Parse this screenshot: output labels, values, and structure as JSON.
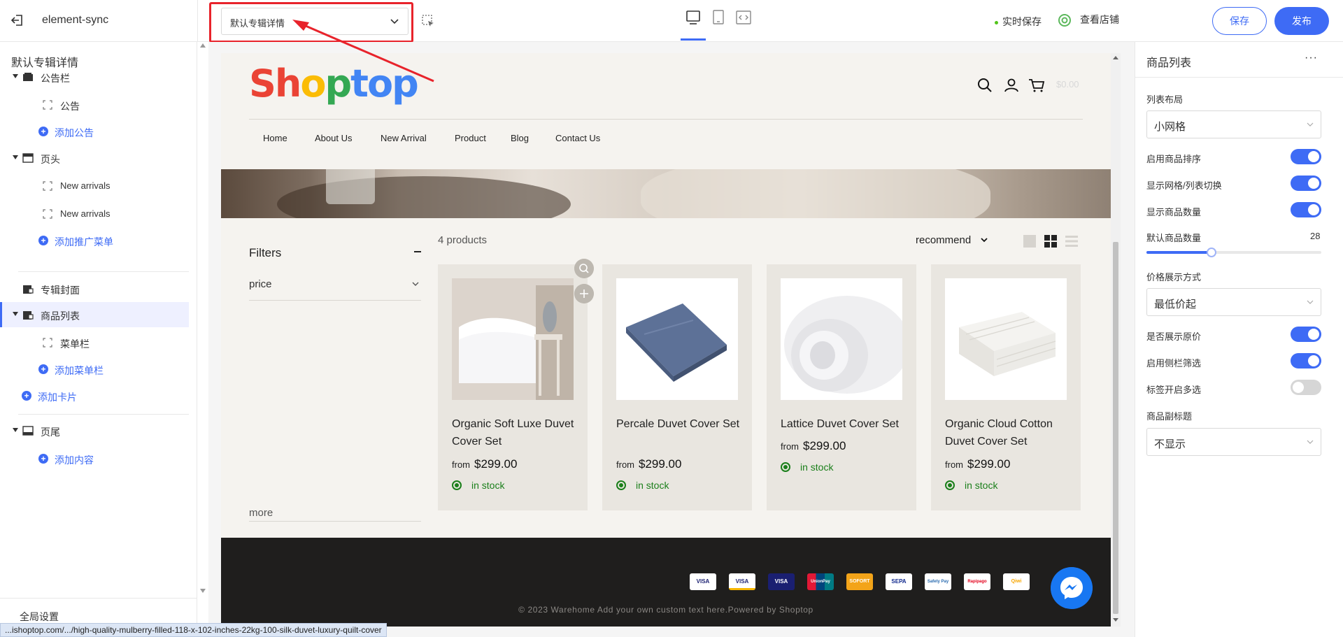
{
  "topbar": {
    "app_title": "element-sync",
    "template_select": "默认专辑详情",
    "autosave": "实时保存",
    "view_store": "查看店铺",
    "save": "保存",
    "publish": "发布",
    "icons": [
      "exit-icon",
      "select-tool-icon",
      "desktop-icon",
      "tablet-icon",
      "code-icon",
      "store-icon"
    ]
  },
  "sidebar": {
    "title": "默认专辑详情",
    "items": [
      {
        "label": "公告栏"
      },
      {
        "label": "公告"
      },
      {
        "label": "添加公告"
      },
      {
        "label": "页头"
      },
      {
        "label": "New arrivals"
      },
      {
        "label": "New arrivals"
      },
      {
        "label": "添加推广菜单"
      },
      {
        "label": "专辑封面"
      },
      {
        "label": "商品列表"
      },
      {
        "label": "菜单栏"
      },
      {
        "label": "添加菜单栏"
      },
      {
        "label": "添加卡片"
      },
      {
        "label": "页尾"
      },
      {
        "label": "添加内容"
      }
    ],
    "global_settings": "全局设置"
  },
  "preview": {
    "logo": {
      "letters": [
        "S",
        "h",
        "o",
        "p",
        "t",
        "o",
        "p"
      ],
      "colors": [
        "#ea4335",
        "#ea4335",
        "#fbbc05",
        "#34a853",
        "#4285f4",
        "#4285f4",
        "#4285f4"
      ]
    },
    "cart_total": "$0.00",
    "nav": [
      "Home",
      "About Us",
      "New Arrival",
      "Product",
      "Blog",
      "Contact Us"
    ],
    "filters": {
      "title": "Filters",
      "price": "price",
      "more": "more"
    },
    "products_count": "4 products",
    "sort": "recommend",
    "products": [
      {
        "name": "Organic Soft Luxe Duvet Cover Set",
        "from": "from",
        "price": "$299.00",
        "stock": "in stock"
      },
      {
        "name": "Percale Duvet Cover Set",
        "from": "from",
        "price": "$299.00",
        "stock": "in stock"
      },
      {
        "name": "Lattice Duvet Cover Set",
        "from": "from",
        "price": "$299.00",
        "stock": "in stock"
      },
      {
        "name": "Organic Cloud Cotton Duvet Cover Set",
        "from": "from",
        "price": "$299.00",
        "stock": "in stock"
      }
    ],
    "payment_icons": [
      "VISA",
      "VISA",
      "VISA",
      "UnionPay",
      "SOFORT",
      "SEPA",
      "Safety Pay",
      "Rapipago",
      "Qiwi"
    ],
    "copyright": "© 2023 Warehome Add your own custom text here.Powered by Shoptop"
  },
  "status_url": "...ishoptop.com/.../high-quality-mulberry-filled-118-x-102-inches-22kg-100-silk-duvet-luxury-quilt-cover",
  "right_panel": {
    "title": "商品列表",
    "more": "···",
    "list_layout_label": "列表布局",
    "list_layout_value": "小网格",
    "enable_sort": "启用商品排序",
    "grid_toggle": "显示网格/列表切换",
    "show_count": "显示商品数量",
    "default_count_label": "默认商品数量",
    "default_count_value": "28",
    "default_count_fraction": 0.37,
    "price_display_label": "价格展示方式",
    "price_display_value": "最低价起",
    "show_original_price": "是否展示原价",
    "sidebar_filter": "启用侧栏筛选",
    "tag_multi": "标签开启多选",
    "subtitle_label": "商品副标题",
    "subtitle_value": "不显示",
    "toggles": {
      "enable_sort": true,
      "grid_toggle": true,
      "show_count": true,
      "show_original_price": true,
      "sidebar_filter": true,
      "tag_multi": false
    }
  },
  "colors": {
    "accent": "#3e6bf5",
    "annotation_red": "#e8232b",
    "stock_green": "#1a7f1a"
  }
}
